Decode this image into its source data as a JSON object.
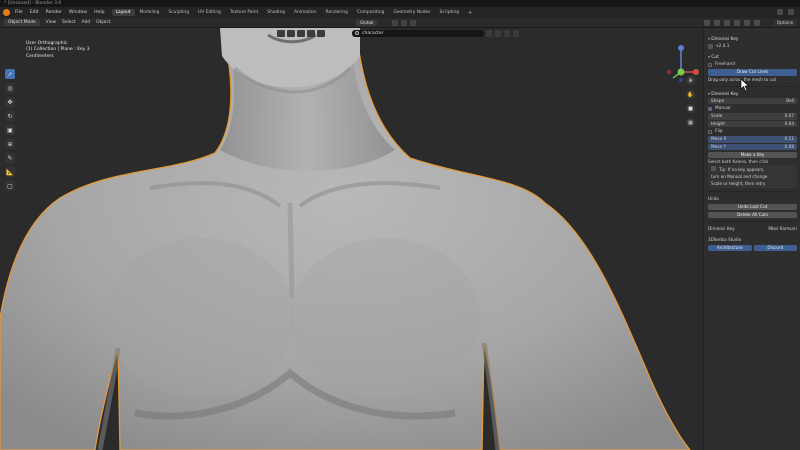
{
  "window": {
    "title": "* [Unsaved] - Blender 3.6"
  },
  "topbar": {
    "menus": [
      "File",
      "Edit",
      "Render",
      "Window",
      "Help"
    ],
    "workspaces": [
      "Layout",
      "Modeling",
      "Sculpting",
      "UV Editing",
      "Texture Paint",
      "Shading",
      "Animation",
      "Rendering",
      "Compositing",
      "Geometry Nodes",
      "Scripting"
    ],
    "active_workspace": "Layout",
    "add_label": "+"
  },
  "header": {
    "mode": "Object Mode",
    "menus": [
      "View",
      "Select",
      "Add",
      "Object"
    ],
    "orientation": "Global",
    "options_label": "Options"
  },
  "viewport": {
    "info": [
      "User Orthographic",
      "(1) Collection | Plane : Key 3",
      "Centimeters"
    ],
    "search_text": "character"
  },
  "toolbar": {
    "tools": [
      "select",
      "cursor",
      "move",
      "rotate",
      "scale",
      "transform",
      "annotate",
      "measure",
      "add-cube"
    ]
  },
  "sidebar": {
    "addon_title": "Dimensi Key",
    "version": "v2.4.1",
    "cut_section": "Cut",
    "freehand_label": "Freehand",
    "draw_cut_button": "Draw Cut Lines",
    "cut_hint": "Drag only across the mesh to cut",
    "dimension_section": "Dimensi Key",
    "shape_label": "Shape",
    "shape_value": "Bell",
    "manual_label": "Manual",
    "width_label": "Scale",
    "width_value": "0.07",
    "height_label": "Height",
    "height_value": "0.04",
    "flip_label": "Flip",
    "move_x_label": "Move X",
    "move_x_value": "0.11",
    "move_y_label": "Move Y",
    "move_y_value": "0.08",
    "make_key_button": "Make a Key",
    "select_hint": "Select both Kalnes, then click",
    "tip_1": "Tip: If no key appears,",
    "tip_2": "turn on Manual and change",
    "tip_3": "Scale or Height, then retry",
    "undo_section": "Undo",
    "undo_button": "Undo Last Cut",
    "delete_button": "Delete All Cuts",
    "credit_left": "Dimensi Key",
    "credit_right": "Mkel Kamsari",
    "studio": "3DSerbia Studio",
    "btn_left": "Architecture",
    "btn_right": "Discord"
  }
}
